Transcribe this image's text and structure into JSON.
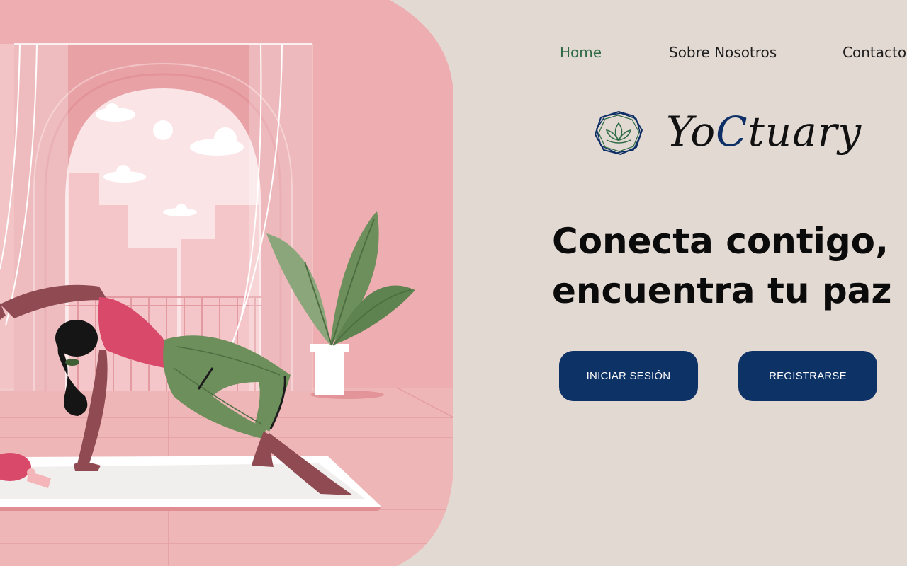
{
  "nav": {
    "items": [
      {
        "label": "Home",
        "active": true
      },
      {
        "label": "Sobre Nosotros",
        "active": false
      },
      {
        "label": "Contacto",
        "active": false
      }
    ]
  },
  "brand": {
    "name_part1": "Yo",
    "name_accent": "C",
    "name_part2": "tuary",
    "logo_icon": "lotus-icon",
    "accent_color": "#0d2f66"
  },
  "hero": {
    "headline_line1": "Conecta contigo,",
    "headline_line2": "encuentra tu paz",
    "illustration": "yoga-illustration"
  },
  "actions": {
    "login_label": "INICIAR SESIÓN",
    "register_label": "REGISTRARSE"
  },
  "colors": {
    "background": "#e3d9d3",
    "illustration_pink": "#eeadb0",
    "button": "#0d3266",
    "nav_active": "#2e6b45"
  }
}
